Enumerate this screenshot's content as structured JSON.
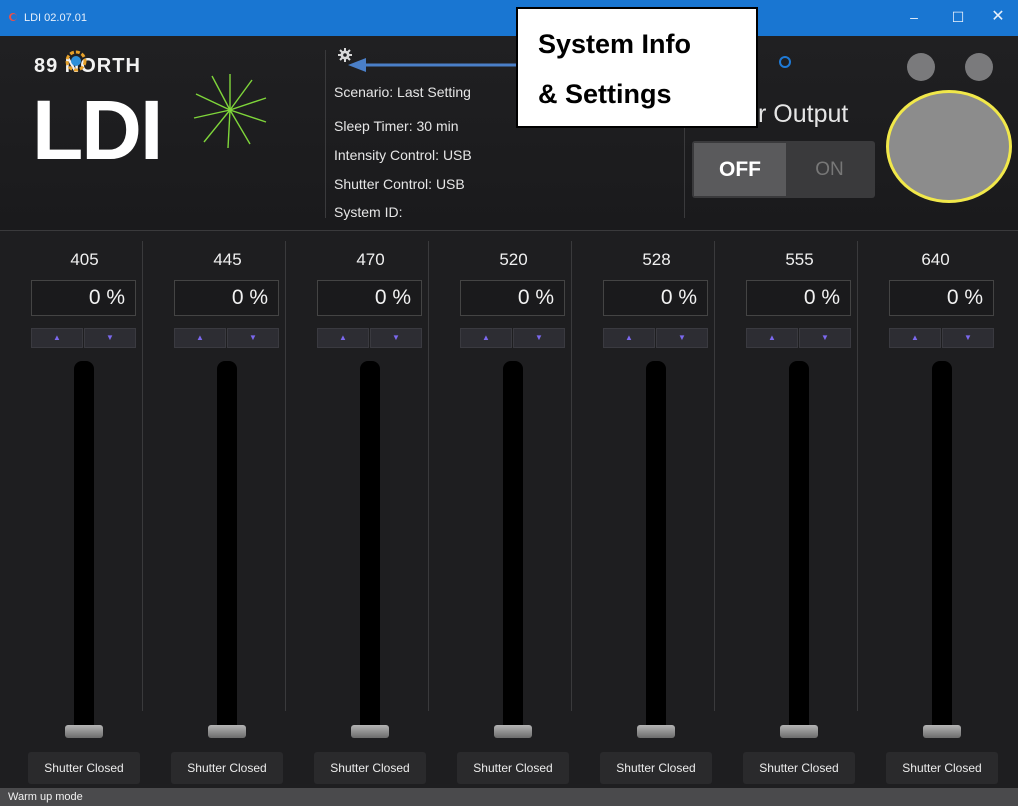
{
  "window": {
    "title": "LDI 02.07.01",
    "minimize_glyph": "–",
    "maximize_glyph": "☐",
    "close_glyph": "✕"
  },
  "brand": {
    "company": "89 NORTH",
    "product": "LDI",
    "logo_icon": "starburst-icon"
  },
  "system_info": {
    "settings_icon": "gear-icon",
    "lines": {
      "scenario": "Scenario: Last Setting",
      "sleep_timer": "Sleep Timer: 30 min",
      "intensity_control": "Intensity Control: USB",
      "shutter_control": "Shutter Control: USB",
      "system_id": "System ID:"
    }
  },
  "callout": {
    "line1": "System Info",
    "line2": "& Settings"
  },
  "laser_output": {
    "label": "r Output",
    "off_label": "OFF",
    "on_label": "ON",
    "state": "OFF"
  },
  "channels": [
    {
      "wavelength": "405",
      "value": "0 %",
      "shutter": "Shutter Closed",
      "level": 0
    },
    {
      "wavelength": "445",
      "value": "0 %",
      "shutter": "Shutter Closed",
      "level": 0
    },
    {
      "wavelength": "470",
      "value": "0 %",
      "shutter": "Shutter Closed",
      "level": 0
    },
    {
      "wavelength": "520",
      "value": "0 %",
      "shutter": "Shutter Closed",
      "level": 0
    },
    {
      "wavelength": "528",
      "value": "0 %",
      "shutter": "Shutter Closed",
      "level": 0
    },
    {
      "wavelength": "555",
      "value": "0 %",
      "shutter": "Shutter Closed",
      "level": 0
    },
    {
      "wavelength": "640",
      "value": "0 %",
      "shutter": "Shutter Closed",
      "level": 0
    }
  ],
  "stepper": {
    "up_glyph": "▲",
    "down_glyph": "▼"
  },
  "status": {
    "text": "Warm up mode"
  },
  "colors": {
    "titlebar": "#1976d2",
    "accent_blue": "#1f7ad6",
    "indicator_ring": "#f1e84a",
    "stepper_arrow": "#7b68ee"
  }
}
